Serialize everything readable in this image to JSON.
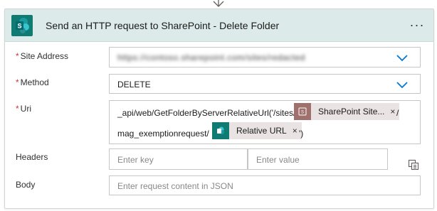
{
  "action": {
    "title": "Send an HTTP request to SharePoint - Delete Folder",
    "menu_label": "···"
  },
  "fields": {
    "site_address": {
      "label": "Site Address",
      "required_mark": "*",
      "value": "https://contoso.sharepoint.com/sites/redacted"
    },
    "method": {
      "label": "Method",
      "required_mark": "*",
      "value": "DELETE"
    },
    "uri": {
      "label": "Uri",
      "required_mark": "*",
      "text_before_token1": "_api/web/GetFolderByServerRelativeUrl('/sites/",
      "text_after_token1": "/",
      "text_before_token2": "mag_exemptionrequest/",
      "text_after_token2": "')",
      "token1": {
        "label": "SharePoint Site...",
        "close": "×",
        "icon": "sharepoint-icon",
        "color": "#a0706c"
      },
      "token2": {
        "label": "Relative URL",
        "close": "×",
        "icon": "sharepoint-icon",
        "color": "#0f7b73"
      }
    },
    "headers": {
      "label": "Headers",
      "key_placeholder": "Enter key",
      "value_placeholder": "Enter value"
    },
    "body": {
      "label": "Body",
      "placeholder": "Enter request content in JSON"
    }
  },
  "colors": {
    "header_bg": "#dcebe9",
    "brand_teal": "#0f7b73",
    "required": "#d13438",
    "chevron": "#0078d4"
  }
}
